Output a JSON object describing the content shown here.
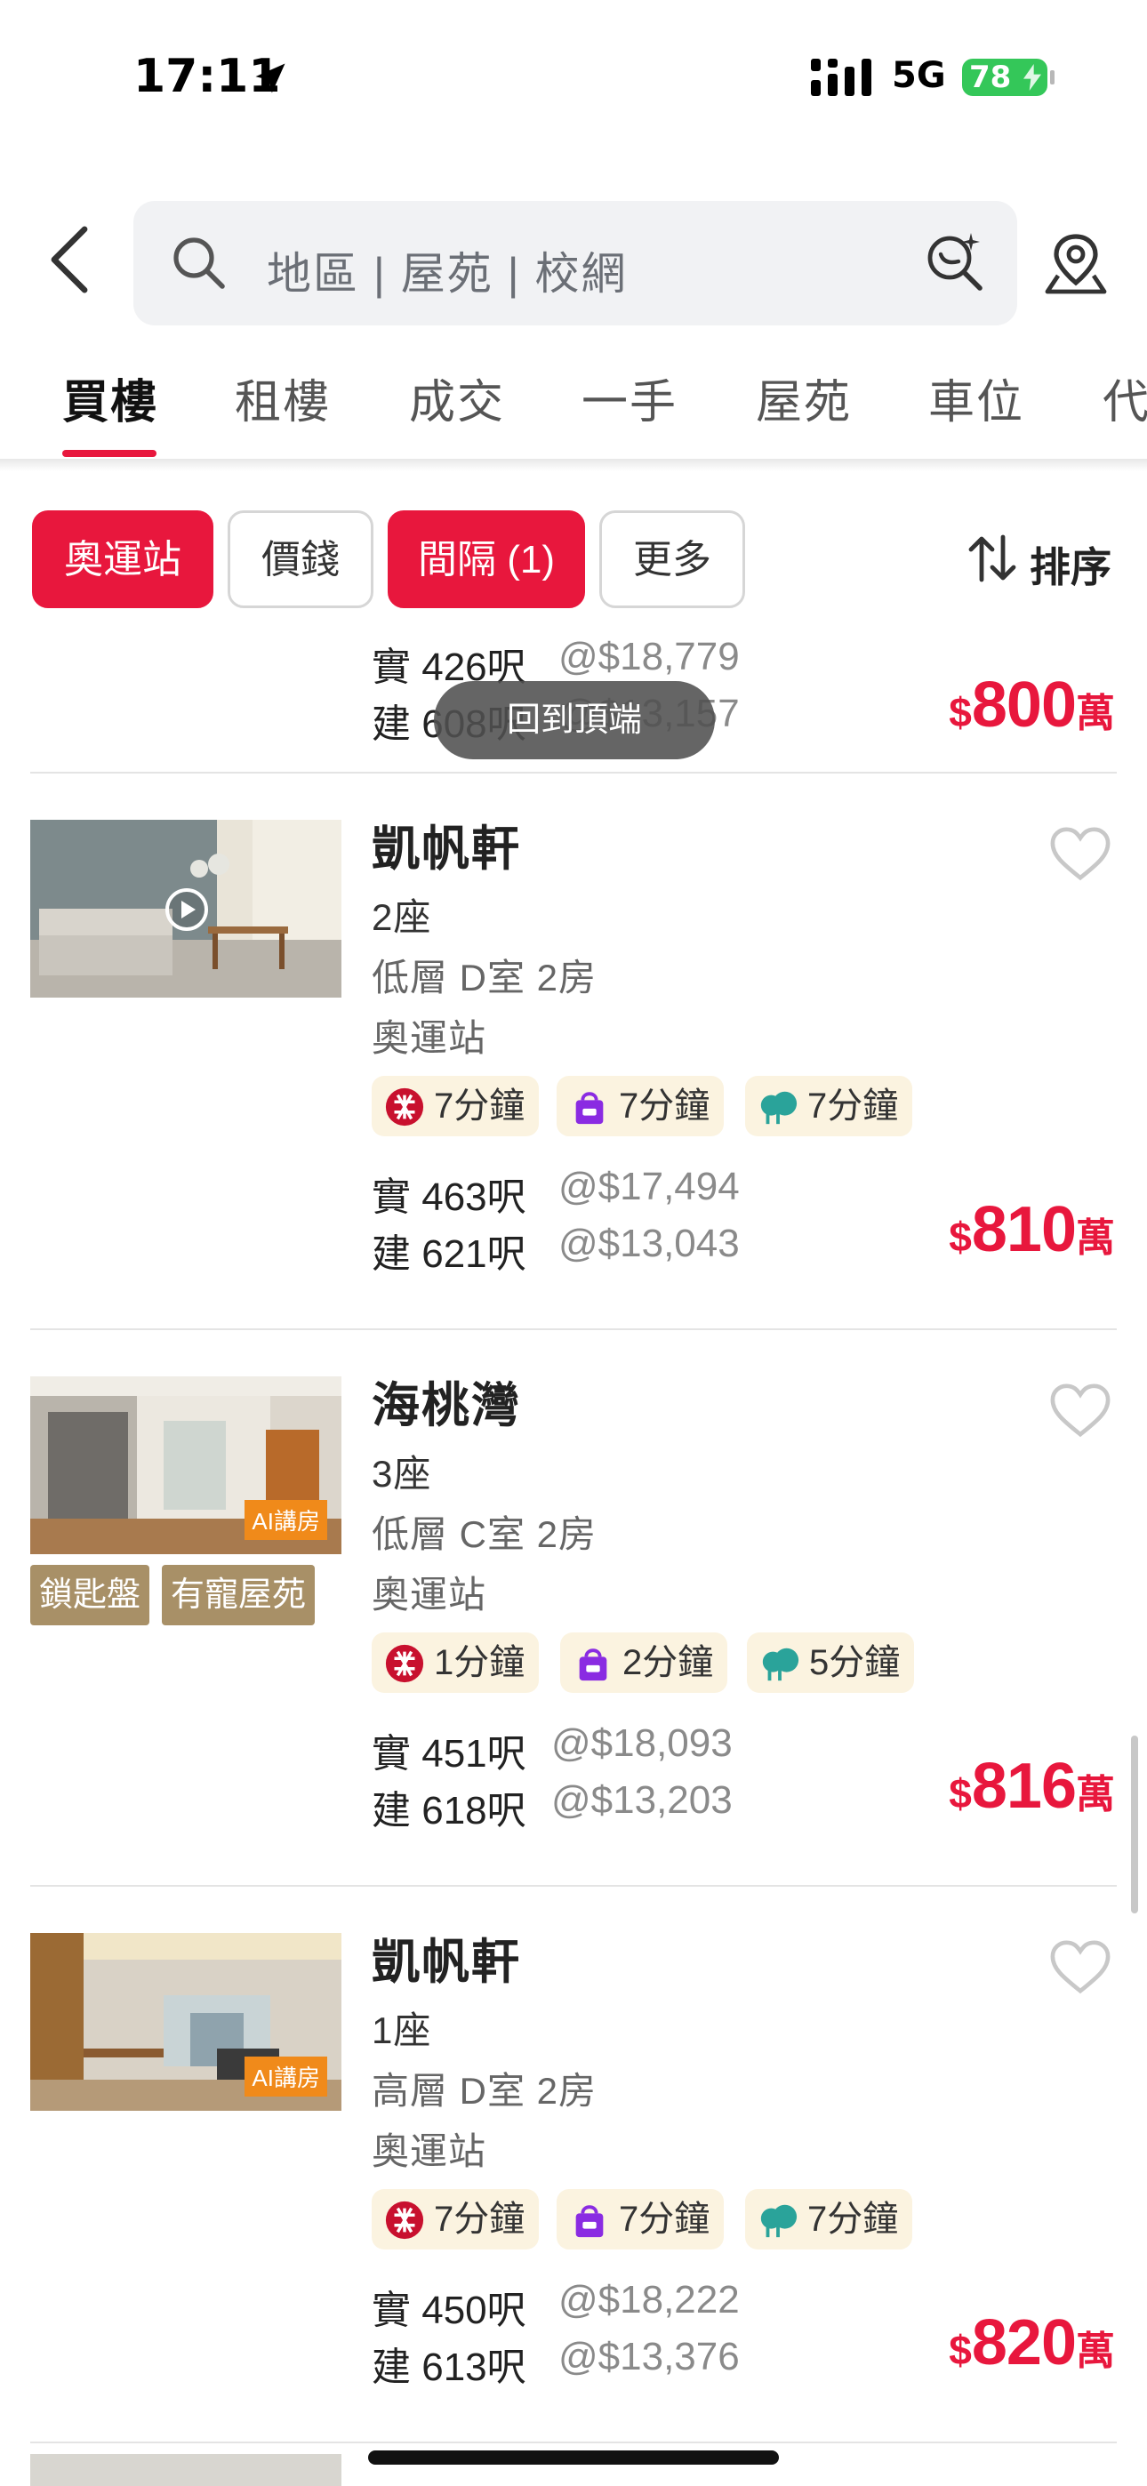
{
  "status_bar": {
    "time": "17:11",
    "network": "5G",
    "battery": "78"
  },
  "search": {
    "placeholder": "地區 | 屋苑 | 校網"
  },
  "tabs": [
    "買樓",
    "租樓",
    "成交",
    "一手",
    "屋苑",
    "車位",
    "代"
  ],
  "active_tab": "買樓",
  "filters": {
    "chips": [
      {
        "label": "奧運站",
        "active": true
      },
      {
        "label": "價錢",
        "active": false
      },
      {
        "label": "間隔 (1)",
        "active": true
      },
      {
        "label": "更多",
        "active": false
      }
    ],
    "sort_label": "排序"
  },
  "back_to_top": "回到頂端",
  "partial_listing": {
    "saleable_area": "實 426呎",
    "saleable_ppf": "@$18,779",
    "gross_area": "建 608呎",
    "gross_ppf": "@$13,157",
    "price_symbol": "$",
    "price": "800",
    "price_unit": "萬"
  },
  "listings": [
    {
      "estate": "凱帆軒",
      "block": "2座",
      "unit": "低層 D室 2房",
      "station": "奧運站",
      "thumb_badge": "",
      "has_video": true,
      "tags": [],
      "commute": [
        {
          "icon": "mtr-icon",
          "label": "7分鐘"
        },
        {
          "icon": "shopping-bag-icon",
          "label": "7分鐘"
        },
        {
          "icon": "park-icon",
          "label": "7分鐘"
        }
      ],
      "saleable_area": "實 463呎",
      "saleable_ppf": "@$17,494",
      "gross_area": "建 621呎",
      "gross_ppf": "@$13,043",
      "price_symbol": "$",
      "price": "810",
      "price_unit": "萬"
    },
    {
      "estate": "海桃灣",
      "block": "3座",
      "unit": "低層 C室 2房",
      "station": "奧運站",
      "thumb_badge": "AI講房",
      "has_video": false,
      "tags": [
        "鎖匙盤",
        "有寵屋苑"
      ],
      "commute": [
        {
          "icon": "mtr-icon",
          "label": "1分鐘"
        },
        {
          "icon": "shopping-bag-icon",
          "label": "2分鐘"
        },
        {
          "icon": "park-icon",
          "label": "5分鐘"
        }
      ],
      "saleable_area": "實 451呎",
      "saleable_ppf": "@$18,093",
      "gross_area": "建 618呎",
      "gross_ppf": "@$13,203",
      "price_symbol": "$",
      "price": "816",
      "price_unit": "萬"
    },
    {
      "estate": "凱帆軒",
      "block": "1座",
      "unit": "高層 D室 2房",
      "station": "奧運站",
      "thumb_badge": "AI講房",
      "has_video": false,
      "tags": [],
      "commute": [
        {
          "icon": "mtr-icon",
          "label": "7分鐘"
        },
        {
          "icon": "shopping-bag-icon",
          "label": "7分鐘"
        },
        {
          "icon": "park-icon",
          "label": "7分鐘"
        }
      ],
      "saleable_area": "實 450呎",
      "saleable_ppf": "@$18,222",
      "gross_area": "建 613呎",
      "gross_ppf": "@$13,376",
      "price_symbol": "$",
      "price": "820",
      "price_unit": "萬"
    }
  ],
  "colors": {
    "accent": "#e8173d",
    "tag_bg": "#a89067",
    "pill_bg": "#fbf3e0",
    "battery": "#34c759"
  }
}
